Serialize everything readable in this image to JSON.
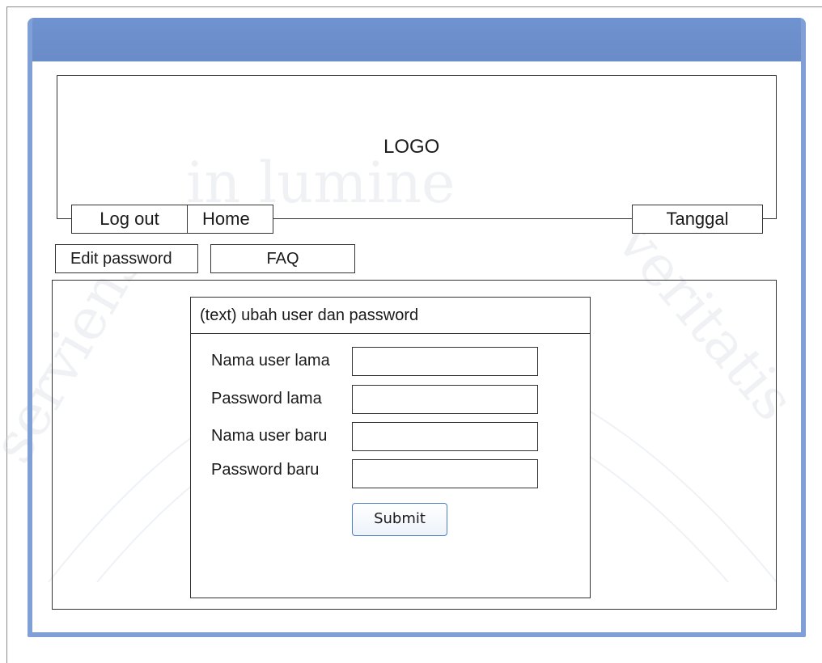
{
  "header": {
    "logo_text": "LOGO",
    "nav": {
      "logout_label": "Log out",
      "home_label": "Home",
      "date_label": "Tanggal"
    }
  },
  "tabs": {
    "edit_password_label": "Edit password",
    "faq_label": "FAQ"
  },
  "form": {
    "title": "(text) ubah user dan password",
    "fields": [
      {
        "label": "Nama user lama",
        "value": ""
      },
      {
        "label": "Password lama",
        "value": ""
      },
      {
        "label": "Nama user baru",
        "value": ""
      },
      {
        "label": "Password baru",
        "value": ""
      }
    ],
    "submit_label": "Submit"
  },
  "watermark": {
    "text_left": "in lumine",
    "text_right": "veritatis",
    "text_arc": "serviens"
  },
  "colors": {
    "titlebar": "#6f93d0",
    "window_frame": "#7f9fd6",
    "submit_border": "#4a7fc4"
  }
}
